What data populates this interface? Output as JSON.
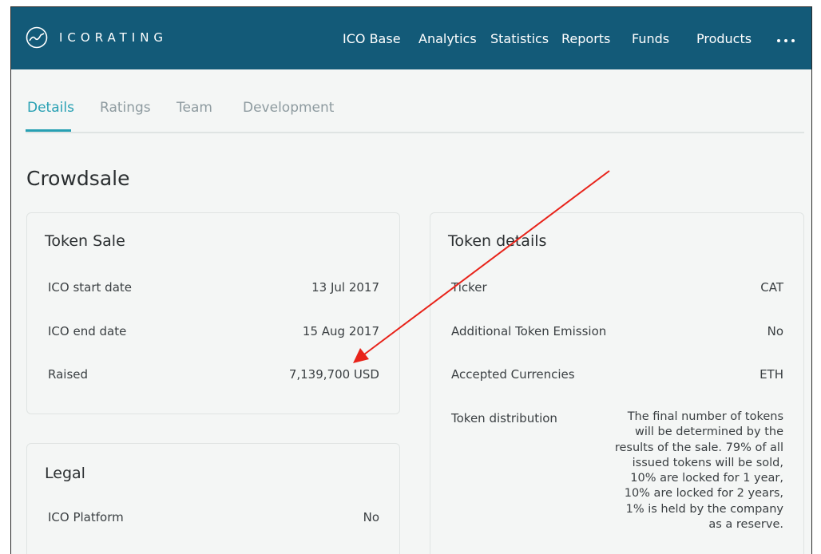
{
  "header": {
    "logo_text": "ICORATING",
    "nav": [
      "ICO Base",
      "Analytics",
      "Statistics",
      "Reports",
      "Funds",
      "Products"
    ],
    "more_label": "more"
  },
  "tabs": [
    "Details",
    "Ratings",
    "Team",
    "Development"
  ],
  "active_tab": "Details",
  "page_title": "Crowdsale",
  "token_sale": {
    "title": "Token Sale",
    "rows": [
      {
        "label": "ICO start date",
        "value": "13 Jul 2017"
      },
      {
        "label": "ICO end date",
        "value": "15 Aug 2017"
      },
      {
        "label": "Raised",
        "value": "7,139,700 USD"
      }
    ]
  },
  "legal": {
    "title": "Legal",
    "rows": [
      {
        "label": "ICO Platform",
        "value": "No"
      }
    ]
  },
  "token_details": {
    "title": "Token details",
    "rows": [
      {
        "label": "Ticker",
        "value": "CAT"
      },
      {
        "label": "Additional Token Emission",
        "value": "No"
      },
      {
        "label": "Accepted Currencies",
        "value": "ETH"
      },
      {
        "label": "Token distribution",
        "value": "The final number of tokens will be determined by the results of the sale. 79% of all issued tokens will be sold, 10% are locked for 1 year, 10% are locked for 2 years, 1% is held by the company as a reserve."
      }
    ]
  },
  "colors": {
    "navbar": "#135a78",
    "accent": "#27a0b3",
    "annotation_arrow": "#e8231a"
  }
}
